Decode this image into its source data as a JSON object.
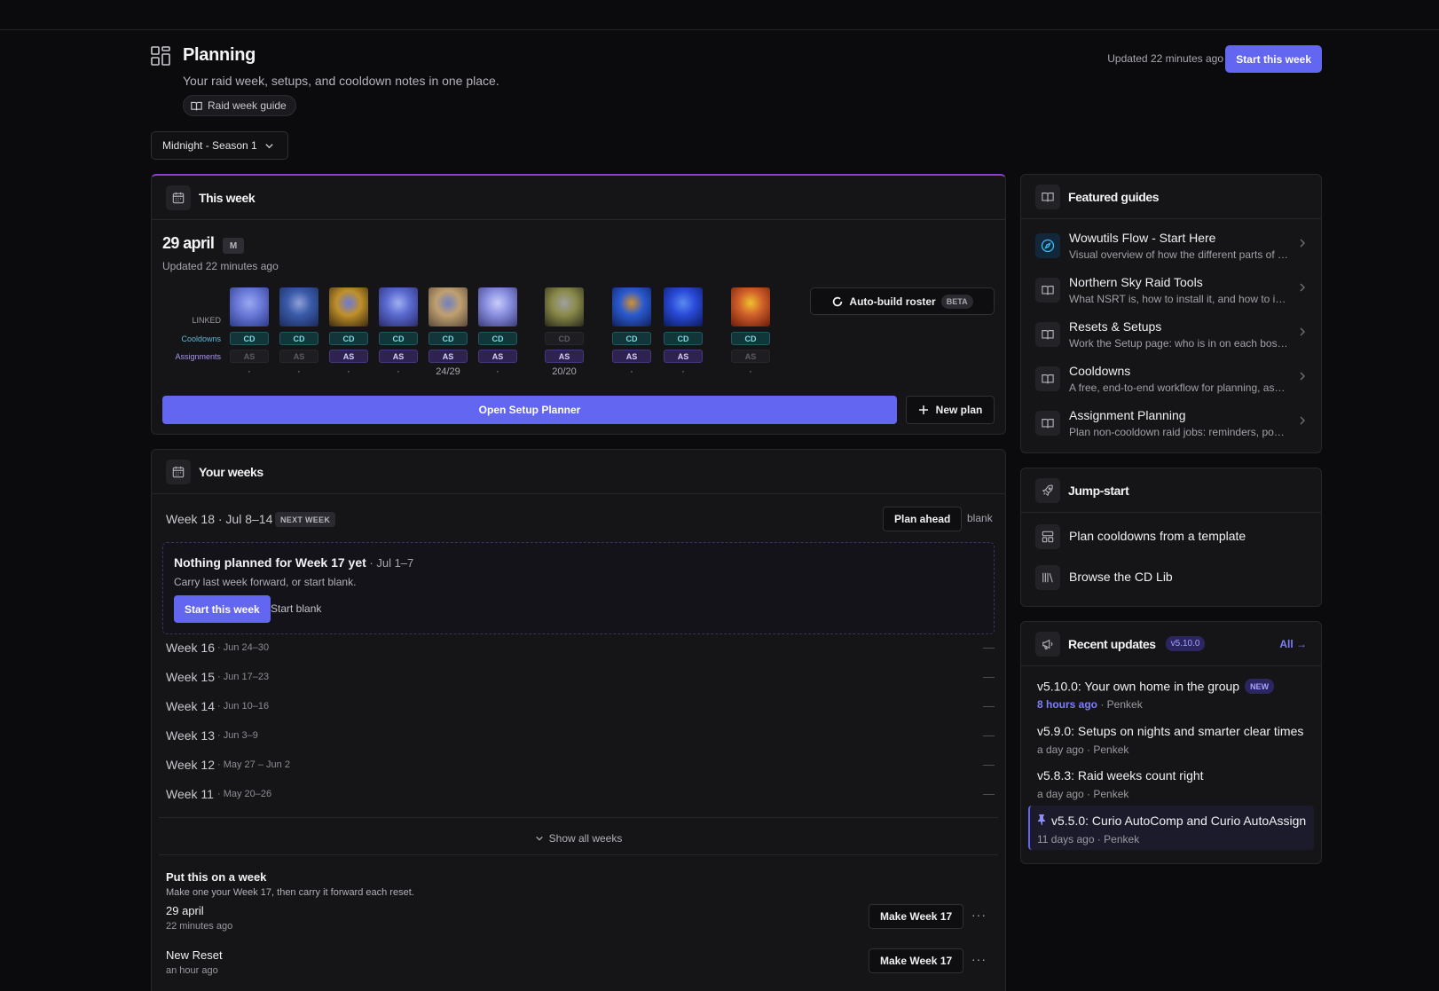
{
  "header": {
    "title": "Planning",
    "subtitle": "Your raid week, setups, and cooldown notes in one place.",
    "guide_label": "Raid week guide",
    "updated": "Updated 22 minutes ago",
    "start_week": "Start this week"
  },
  "season": {
    "selected": "Midnight - Season 1"
  },
  "this_week": {
    "title": "This week",
    "plan_name": "29 april",
    "difficulty": "M",
    "updated": "Updated 22 minutes ago",
    "row_labels": {
      "linked": "LINKED",
      "cooldowns": "Cooldowns",
      "assignments": "Assignments"
    },
    "bosses": [
      {
        "cd": "CD",
        "as": "AS",
        "cd_on": true,
        "as_on": false,
        "progress": "·",
        "colors": [
          "#2a3a8a",
          "#6a7ad8",
          "#9aa8f0"
        ]
      },
      {
        "cd": "CD",
        "as": "AS",
        "cd_on": true,
        "as_on": false,
        "progress": "·",
        "colors": [
          "#1a2a5a",
          "#3a5aa8",
          "#8fa0d8"
        ]
      },
      {
        "cd": "CD",
        "as": "AS",
        "cd_on": true,
        "as_on": true,
        "progress": "·",
        "colors": [
          "#3a2a10",
          "#c0902a",
          "#6a7ad8"
        ]
      },
      {
        "cd": "CD",
        "as": "AS",
        "cd_on": true,
        "as_on": true,
        "progress": "·",
        "colors": [
          "#2a2a6a",
          "#5a6ad0",
          "#a0b0f0"
        ]
      },
      {
        "cd": "CD",
        "as": "AS",
        "cd_on": true,
        "as_on": true,
        "progress": "24/29",
        "colors": [
          "#5a4a3a",
          "#c0a070",
          "#7080c0"
        ]
      },
      {
        "cd": "CD",
        "as": "AS",
        "cd_on": true,
        "as_on": true,
        "progress": "·",
        "colors": [
          "#3a3a7a",
          "#8a90e0",
          "#c8ccf8"
        ]
      },
      {
        "cd": "CD",
        "as": "AS",
        "cd_on": false,
        "as_on": true,
        "progress": "20/20",
        "colors": [
          "#2a2a1a",
          "#8a8a4a",
          "#a0a0a0"
        ]
      },
      {
        "cd": "CD",
        "as": "AS",
        "cd_on": true,
        "as_on": true,
        "progress": "·",
        "colors": [
          "#10205a",
          "#2a5ad0",
          "#d09030"
        ]
      },
      {
        "cd": "CD",
        "as": "AS",
        "cd_on": true,
        "as_on": true,
        "progress": "·",
        "colors": [
          "#0a1a5a",
          "#2a4ad8",
          "#5a8af0"
        ]
      },
      {
        "cd": "CD",
        "as": "AS",
        "cd_on": true,
        "as_on": false,
        "progress": "·",
        "colors": [
          "#6a1a0a",
          "#d0602a",
          "#f0c030"
        ]
      }
    ],
    "auto_build": "Auto-build roster",
    "beta": "BETA",
    "open_setup": "Open Setup Planner",
    "new_plan": "New plan"
  },
  "your_weeks": {
    "title": "Your weeks",
    "next": "Week 18 · Jul 8–14",
    "next_badge": "NEXT WEEK",
    "plan_ahead": "Plan ahead",
    "blank": "blank",
    "nothing_title": "Nothing planned for Week 17 yet",
    "nothing_dates": " · Jul 1–7",
    "nothing_sub": "Carry last week forward, or start blank.",
    "start_week": "Start this week",
    "start_blank": "Start blank",
    "weeks": [
      {
        "name": "Week 16",
        "dates": "· Jun 24–30",
        "status": "—"
      },
      {
        "name": "Week 15",
        "dates": "· Jun 17–23",
        "status": "—"
      },
      {
        "name": "Week 14",
        "dates": "· Jun 10–16",
        "status": "—"
      },
      {
        "name": "Week 13",
        "dates": "· Jun 3–9",
        "status": "—"
      },
      {
        "name": "Week 12",
        "dates": "· May 27 – Jun 2",
        "status": "—"
      },
      {
        "name": "Week 11",
        "dates": "· May 20–26",
        "status": "—"
      }
    ],
    "show_all": "Show all weeks",
    "put_title": "Put this on a week",
    "put_sub": "Make one your Week 17, then carry it forward each reset.",
    "plans": [
      {
        "name": "29 april",
        "time": "22 minutes ago",
        "action": "Make Week 17"
      },
      {
        "name": "New Reset",
        "time": "an hour ago",
        "action": "Make Week 17"
      }
    ]
  },
  "featured": {
    "title": "Featured guides",
    "items": [
      {
        "title": "Wowutils Flow - Start Here",
        "desc": "Visual overview of how the different parts of Wowutils fit together",
        "icon": "compass-icon"
      },
      {
        "title": "Northern Sky Raid Tools",
        "desc": "What NSRT is, how to install it, and how to import notes",
        "icon": "book-icon"
      },
      {
        "title": "Resets & Setups",
        "desc": "Work the Setup page: who is in on each boss and more",
        "icon": "book-icon"
      },
      {
        "title": "Cooldowns",
        "desc": "A free, end-to-end workflow for planning, assigning cooldowns",
        "icon": "book-icon"
      },
      {
        "title": "Assignment Planning",
        "desc": "Plan non-cooldown raid jobs: reminders, positions and more",
        "icon": "book-icon"
      }
    ]
  },
  "jump_start": {
    "title": "Jump-start",
    "items": [
      {
        "label": "Plan cooldowns from a template",
        "icon": "template-icon"
      },
      {
        "label": "Browse the CD Lib",
        "icon": "library-icon"
      }
    ]
  },
  "updates": {
    "title": "Recent updates",
    "version": "v5.10.0",
    "all": "All →",
    "items": [
      {
        "title": "v5.10.0: Your own home in the group",
        "badge": "NEW",
        "time": "8 hours ago",
        "author": " · Penkek"
      },
      {
        "title": "v5.9.0: Setups on nights and smarter clear times",
        "time": "a day ago",
        "author": " · Penkek"
      },
      {
        "title": "v5.8.3: Raid weeks count right",
        "time": "a day ago",
        "author": " · Penkek"
      },
      {
        "title": "v5.5.0: Curio AutoComp and Curio AutoAssign",
        "time": "11 days ago",
        "author": " · Penkek",
        "pinned": true
      }
    ]
  },
  "colors": {
    "accent": "#6366f1",
    "cd": "#7fd8e4",
    "as": "#d6cfff",
    "top_border": "#8b3fd6"
  }
}
